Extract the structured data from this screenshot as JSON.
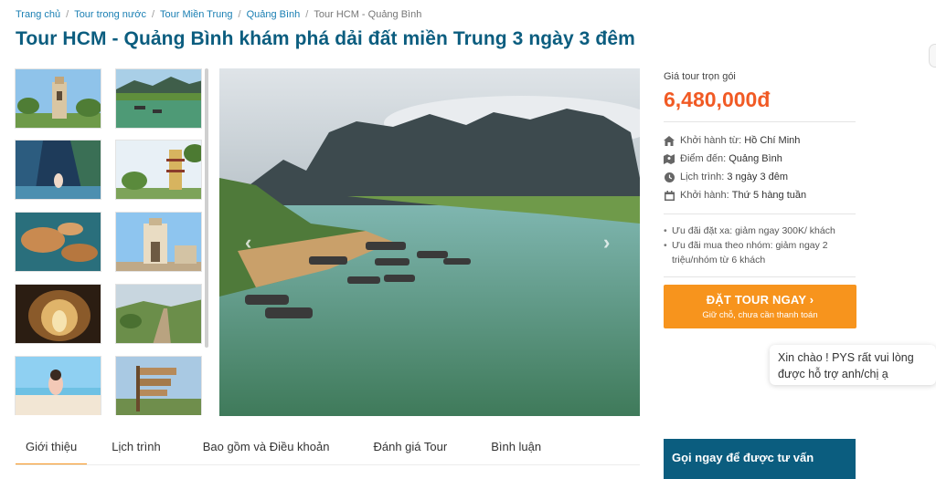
{
  "breadcrumb": {
    "items": [
      "Trang chủ",
      "Tour trong nước",
      "Tour Miền Trung",
      "Quảng Bình"
    ],
    "current": "Tour HCM - Quảng Bình"
  },
  "title": "Tour HCM - Quảng Bình khám phá dải đất miền Trung 3 ngày 3 đêm",
  "gallery": {
    "thumbnails": [
      "church-tower",
      "river-boats",
      "cave-girl",
      "pagoda-tower",
      "cave-pool",
      "church-gate",
      "cave-interior",
      "hill-road",
      "beach-girl",
      "signpost"
    ],
    "hero": "river-mountains-boats",
    "prev_icon": "‹",
    "next_icon": "›"
  },
  "sidebar": {
    "price_label": "Giá tour trọn gói",
    "price": "6,480,000đ",
    "info": [
      {
        "icon": "home-icon",
        "key": "Khởi hành từ:",
        "value": "Hồ Chí Minh"
      },
      {
        "icon": "map-icon",
        "key": "Điểm đến:",
        "value": "Quảng Bình"
      },
      {
        "icon": "clock-icon",
        "key": "Lịch trình:",
        "value": "3 ngày 3 đêm"
      },
      {
        "icon": "calendar-icon",
        "key": "Khởi hành:",
        "value": "Thứ 5 hàng tuần"
      }
    ],
    "promos": [
      "Ưu đãi đặt xa: giảm ngay 300K/ khách",
      "Ưu đãi mua theo nhóm: giảm ngay 2 triệu/nhóm từ 6 khách"
    ],
    "book_button": {
      "label": "ĐẶT TOUR NGAY",
      "sub": "Giữ chỗ, chưa cần thanh toán"
    },
    "consult_button": "Gọi ngay để được tư vấn"
  },
  "chat": {
    "message": "Xin chào ! PYS rất vui lòng được hỗ trợ anh/chị ạ"
  },
  "tabs": [
    "Giới thiệu",
    "Lịch trình",
    "Bao gồm và Điều khoản",
    "Đánh giá Tour",
    "Bình luận"
  ],
  "colors": {
    "title": "#0b5d7f",
    "price": "#f15a24",
    "button": "#f7941d",
    "link": "#1a7fb3"
  }
}
